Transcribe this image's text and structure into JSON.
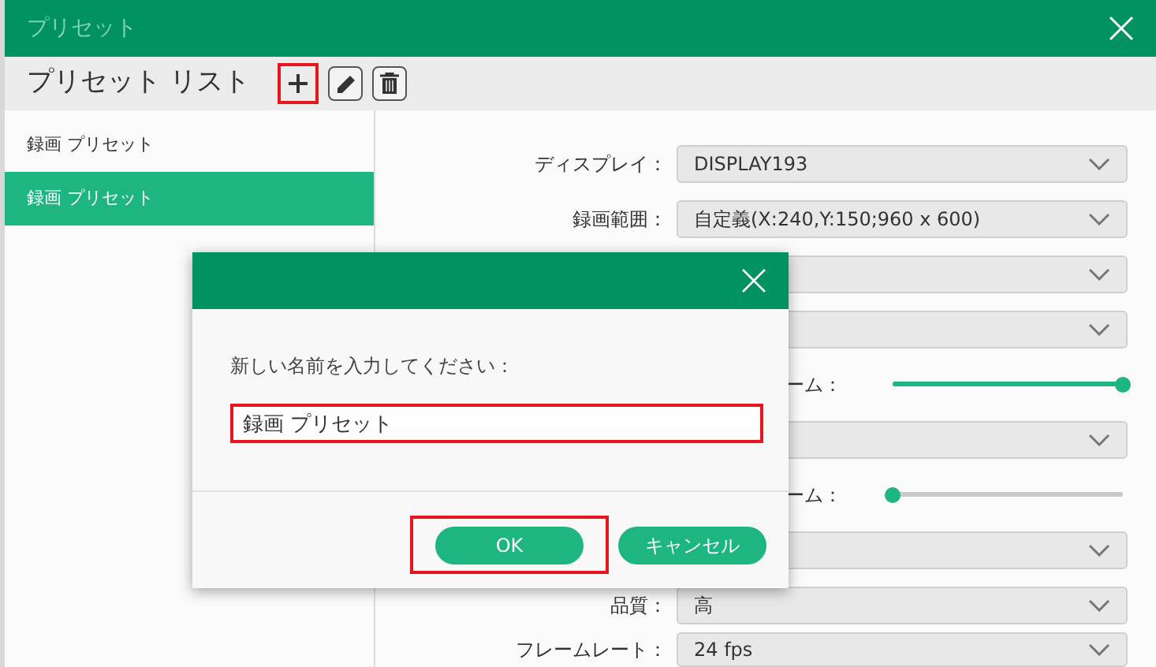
{
  "window": {
    "title": "プリセット"
  },
  "toolbar": {
    "title": "プリセット リスト",
    "buttons": [
      {
        "kind": "add",
        "highlighted": true
      },
      {
        "kind": "edit",
        "highlighted": false
      },
      {
        "kind": "delete",
        "highlighted": false
      }
    ]
  },
  "sidebar": {
    "items": [
      {
        "label": "録画 プリセット",
        "selected": false
      },
      {
        "label": "録画 プリセット",
        "selected": true
      }
    ]
  },
  "settings": [
    {
      "kind": "select",
      "label": "ディスプレイ：",
      "value": "DISPLAY193"
    },
    {
      "kind": "select",
      "label": "録画範囲：",
      "value": "自定義(X:240,Y:150;960 x 600)"
    },
    {
      "kind": "select"
    },
    {
      "kind": "select"
    },
    {
      "kind": "slider",
      "label": "ーム：",
      "level": 1
    },
    {
      "kind": "select"
    },
    {
      "kind": "slider",
      "label": "ーム：",
      "level": 0
    },
    {
      "kind": "select"
    },
    {
      "kind": "select",
      "label": "品質：",
      "value": "高"
    },
    {
      "kind": "select",
      "label": "フレームレート：",
      "value": "24 fps"
    }
  ],
  "dialog": {
    "prompt": "新しい名前を入力してください：",
    "input": {
      "value": "録画 プリセット",
      "highlighted": true
    },
    "buttons": [
      {
        "label": "OK",
        "highlighted": true
      },
      {
        "label": "キャンセル",
        "highlighted": false
      }
    ]
  }
}
